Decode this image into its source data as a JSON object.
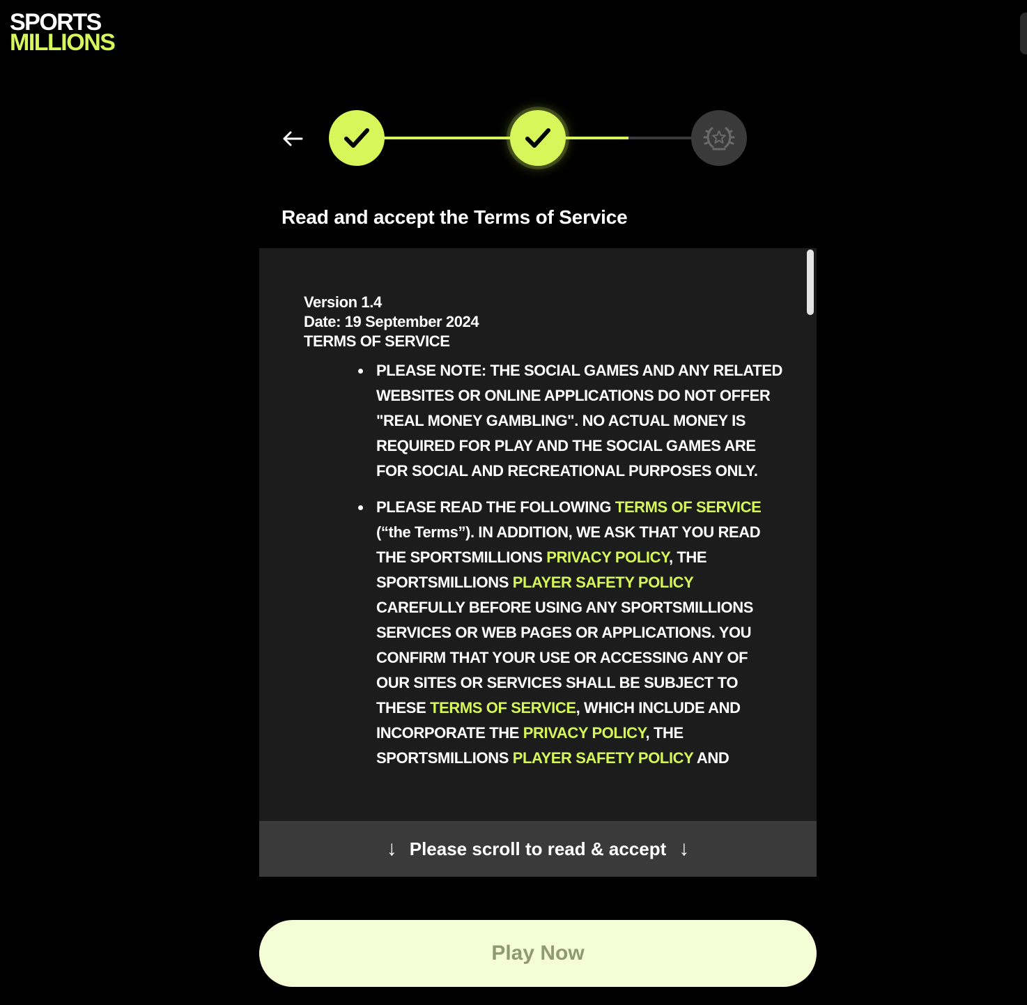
{
  "brand": {
    "logo_line1": "SPORTS",
    "logo_line2": "MILLIONS",
    "accent_color": "#d7f65a"
  },
  "stepper": {
    "back_icon": "arrow-left-icon",
    "steps": [
      {
        "state": "completed",
        "icon": "checkmark-icon"
      },
      {
        "state": "completed",
        "icon": "checkmark-icon"
      },
      {
        "state": "pending",
        "icon": "laurel-wreath-star-icon"
      }
    ]
  },
  "heading": "Read and accept the Terms of Service",
  "terms": {
    "version": "Version 1.4",
    "date": "Date: 19 September 2024",
    "title": "TERMS OF SERVICE",
    "para1": "PLEASE NOTE: THE SOCIAL GAMES AND ANY RELATED WEBSITES OR ONLINE APPLICATIONS DO NOT OFFER \"REAL MONEY GAMBLING\". NO ACTUAL MONEY IS REQUIRED FOR PLAY AND THE SOCIAL GAMES ARE FOR SOCIAL AND RECREATIONAL PURPOSES ONLY.",
    "para2": {
      "t1": "PLEASE READ THE FOLLOWING ",
      "link1": "TERMS OF SERVICE",
      "t2": " (“the Terms”). IN ADDITION, WE ASK THAT YOU READ THE SPORTSMILLIONS ",
      "link2": "PRIVACY POLICY",
      "t3": ", THE SPORTSMILLIONS ",
      "link3": "PLAYER SAFETY POLICY",
      "t4": " CAREFULLY BEFORE USING ANY SPORTSMILLIONS SERVICES OR WEB PAGES OR APPLICATIONS. YOU CONFIRM THAT YOUR USE OR ACCESSING ANY OF OUR SITES OR SERVICES SHALL BE SUBJECT TO THESE ",
      "link4": "TERMS OF SERVICE",
      "t5": ", WHICH INCLUDE AND INCORPORATE THE ",
      "link5": "PRIVACY POLICY",
      "t6": ", THE SPORTSMILLIONS ",
      "link6": "PLAYER SAFETY POLICY",
      "t7": " AND"
    }
  },
  "scroll_hint": {
    "text": "Please scroll to read & accept",
    "arrow": "↓"
  },
  "play_button": {
    "label": "Play Now",
    "state": "disabled"
  }
}
